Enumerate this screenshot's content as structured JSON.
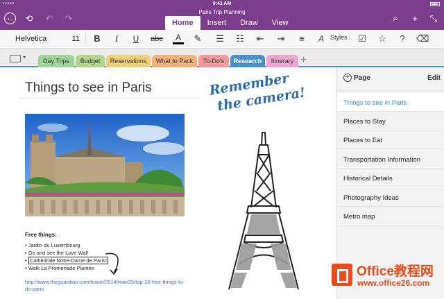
{
  "status": {
    "carrier": "•••••",
    "time": "9:41 AM"
  },
  "app": {
    "title": "Paris Trip Planning"
  },
  "ribbon": {
    "tabs": [
      {
        "label": "Home",
        "active": true
      },
      {
        "label": "Insert",
        "active": false
      },
      {
        "label": "Draw",
        "active": false
      },
      {
        "label": "View",
        "active": false
      }
    ],
    "back_icon": "←",
    "notebooks_icon": "⟲",
    "undo_icon": "↶",
    "redo_icon": "↷",
    "search_icon": "⌕",
    "share_icon": "+",
    "collapse_icon": "⤡"
  },
  "format": {
    "font_name": "Helvetica",
    "font_size": "11",
    "bold": "B",
    "italic": "I",
    "underline": "U",
    "strike": "abc",
    "font_color": "A",
    "font_color_value": "#000000",
    "highlight": "✎",
    "bullets": "☰",
    "numbering": "☷",
    "outdent": "⇤",
    "indent": "⇥",
    "align": "≡",
    "styles_icon": "A",
    "styles_label": "Styles",
    "todo": "☑",
    "tag": "☆",
    "help": "?",
    "clear": "⌫"
  },
  "sections": [
    {
      "label": "Day Trips",
      "color": "#9fd49a"
    },
    {
      "label": "Budget",
      "color": "#b2d68a"
    },
    {
      "label": "Reservations",
      "color": "#f1cf7a"
    },
    {
      "label": "What to Pack",
      "color": "#f3b27d"
    },
    {
      "label": "To-Do's",
      "color": "#f09a9a"
    },
    {
      "label": "Research",
      "color": "#4a90c8",
      "active": true
    },
    {
      "label": "Itinerary",
      "color": "#eda6d4"
    }
  ],
  "pages": {
    "header_label": "Page",
    "edit_label": "Edit",
    "items": [
      {
        "label": "Things to see in Paris",
        "active": true
      },
      {
        "label": "Places to Stay"
      },
      {
        "label": "Places to Eat"
      },
      {
        "label": "Transportation Information"
      },
      {
        "label": "Historical Details"
      },
      {
        "label": "Photography Ideas"
      },
      {
        "label": "Metro map"
      }
    ]
  },
  "note": {
    "title": "Things to see in Paris",
    "free_title": "Free things:",
    "free_items": [
      "Jardin du Luxembourg",
      "Go and see the Love Wall",
      "Cathédrale Notre-Dame de Paris!",
      "Walk La Promenade Plantée"
    ],
    "link": "http://www.theguardian.com/travel/2014/mar/25/top-10-free-things-to-do-paris",
    "handwriting": [
      "Remember",
      "the camera!"
    ]
  },
  "watermark": {
    "title": "Office教程网",
    "url": "www.office26.com"
  },
  "colors": {
    "accent": "#7c3d8c",
    "selection": "#4a90c8",
    "active_page": "#3b8bc9"
  }
}
